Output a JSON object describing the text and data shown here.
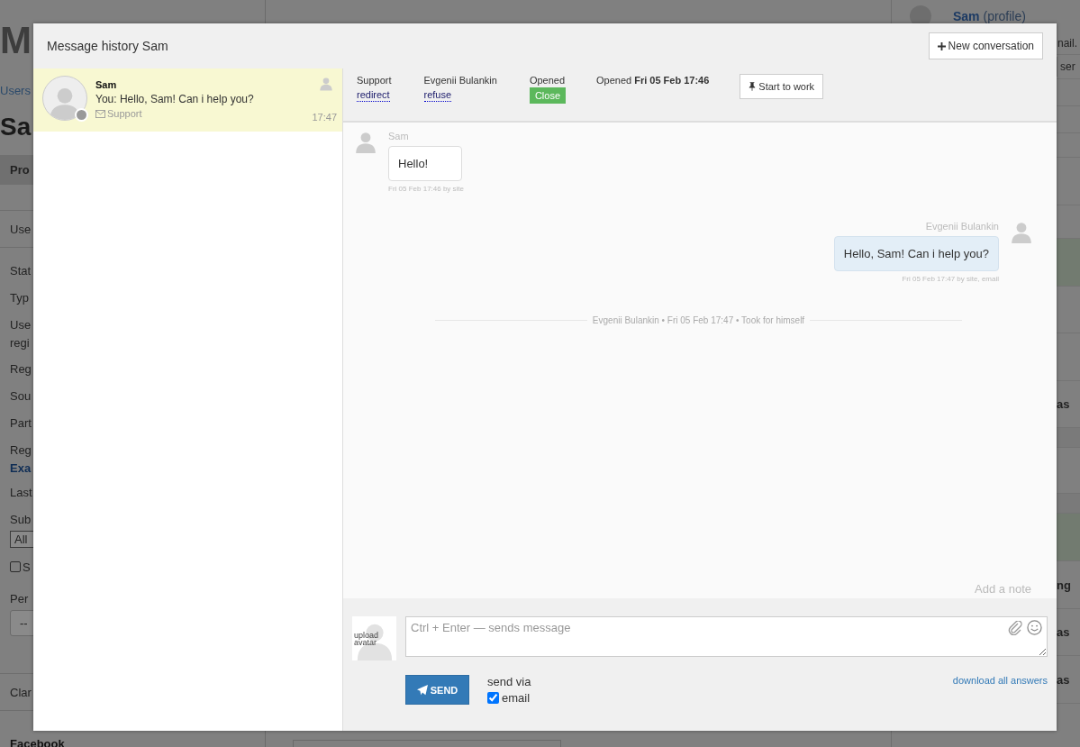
{
  "background": {
    "left": [
      {
        "kind": "title",
        "text": "M"
      },
      {
        "kind": "crumb",
        "text": "Users"
      },
      {
        "kind": "name",
        "text": "Sa"
      },
      {
        "kind": "tab",
        "text": "Pro"
      },
      {
        "kind": "section",
        "text": "Use"
      },
      {
        "kind": "label",
        "text": "Stat"
      },
      {
        "kind": "label",
        "text": "Typ"
      },
      {
        "kind": "label",
        "text": "Use"
      },
      {
        "kind": "label-cont",
        "text": "regi"
      },
      {
        "kind": "label",
        "text": "Reg"
      },
      {
        "kind": "label",
        "text": "Sou"
      },
      {
        "kind": "label",
        "text": "Part"
      },
      {
        "kind": "label",
        "text": "Reg"
      },
      {
        "kind": "link",
        "text": "Exa"
      },
      {
        "kind": "label",
        "text": "Last"
      },
      {
        "kind": "label",
        "text": "Sub"
      },
      {
        "kind": "select",
        "text": "All"
      },
      {
        "kind": "checkbox",
        "text": "S",
        "checked": false
      },
      {
        "kind": "label",
        "text": "Per"
      },
      {
        "kind": "select-wide",
        "text": "--"
      },
      {
        "kind": "section",
        "text": "Clar"
      },
      {
        "kind": "footer",
        "text": "Facebook"
      }
    ],
    "right": [
      {
        "kind": "profile",
        "name": "Sam",
        "suffix": "(profile)"
      },
      {
        "kind": "email",
        "text": "nail."
      },
      {
        "kind": "button",
        "text": "ser"
      },
      {
        "kind": "blank"
      },
      {
        "kind": "blank"
      },
      {
        "kind": "blank"
      },
      {
        "kind": "blank"
      },
      {
        "kind": "blank"
      },
      {
        "kind": "green"
      },
      {
        "kind": "blank"
      },
      {
        "kind": "blank"
      },
      {
        "kind": "row",
        "text": "as"
      },
      {
        "kind": "blank"
      },
      {
        "kind": "blank"
      },
      {
        "kind": "blank"
      },
      {
        "kind": "green"
      },
      {
        "kind": "row",
        "text": "ng"
      },
      {
        "kind": "row",
        "text": "as"
      },
      {
        "kind": "row",
        "text": "as"
      }
    ]
  },
  "modal": {
    "title": "Message history Sam",
    "new_conversation_button": "New conversation",
    "conversations": [
      {
        "name": "Sam",
        "preview": "You: Hello, Sam! Can i help you?",
        "channel": "Support",
        "time": "17:47",
        "selected": true,
        "online": false
      }
    ],
    "ticket": {
      "department": "Support",
      "department_action": "redirect",
      "assignee": "Evgenii Bulankin",
      "assignee_action": "refuse",
      "status": "Opened",
      "status_button": "Close",
      "opened": "Opened **Fri 05 Feb 17:46**",
      "work_button": "Start to work"
    },
    "messages": [
      {
        "kind": "incoming",
        "author": "Sam",
        "text": "Hello!",
        "meta": "Fri 05 Feb 17:46 by site"
      },
      {
        "kind": "outgoing",
        "author": "Evgenii Bulankin",
        "text": "Hello, Sam! Can i help you?",
        "meta": "Fri 05 Feb 17:47 by site, email"
      },
      {
        "kind": "event",
        "text": "Evgenii Bulankin • Fri 05 Feb 17:47 • Took for himself"
      }
    ],
    "add_note": "Add a note",
    "composer": {
      "avatar_text": "upload avatar",
      "placeholder": "Ctrl + Enter — sends message",
      "send_button": "SEND",
      "send_via": "send via",
      "channels": [
        {
          "label": "email",
          "checked": true
        }
      ],
      "download_link": "download all answers"
    }
  }
}
